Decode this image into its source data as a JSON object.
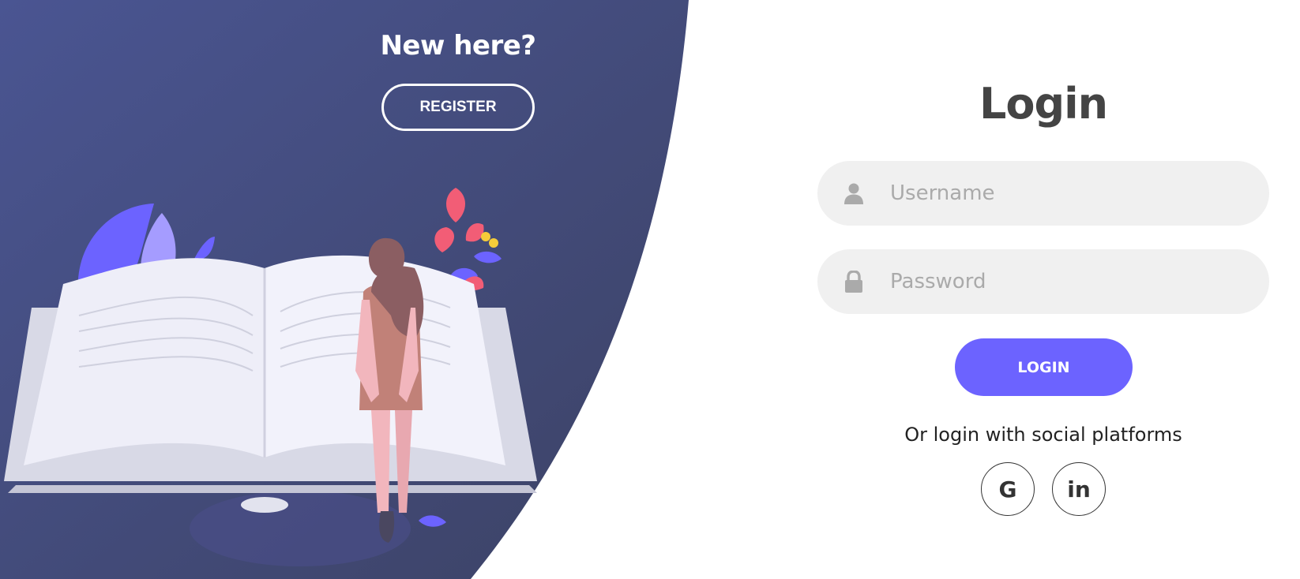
{
  "left_panel": {
    "title": "New here?",
    "register_label": "REGISTER"
  },
  "login_form": {
    "title": "Login",
    "username_placeholder": "Username",
    "password_placeholder": "Password",
    "login_label": "LOGIN",
    "social_text": "Or login with social platforms",
    "social": [
      {
        "name": "google",
        "label": "G",
        "icon": "google-icon"
      },
      {
        "name": "linkedin",
        "label": "in",
        "icon": "linkedin-icon"
      }
    ]
  },
  "colors": {
    "panel_bg_start": "#4a5592",
    "panel_bg_end": "#3f4568",
    "accent": "#6c63ff",
    "input_bg": "#f0f0f0",
    "title_text": "#444444"
  }
}
